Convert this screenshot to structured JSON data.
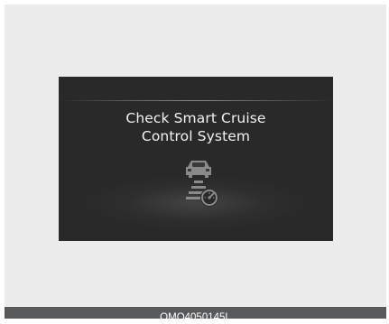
{
  "display": {
    "message_line1": "Check Smart Cruise",
    "message_line2": "Control System",
    "icon": "smart-cruise-control-warning-icon"
  },
  "caption": {
    "code": "OMQ4050145L"
  },
  "colors": {
    "background": "#ececed",
    "screen": "#292929",
    "text": "#f2f2f2",
    "caption_bar": "#58595b"
  }
}
